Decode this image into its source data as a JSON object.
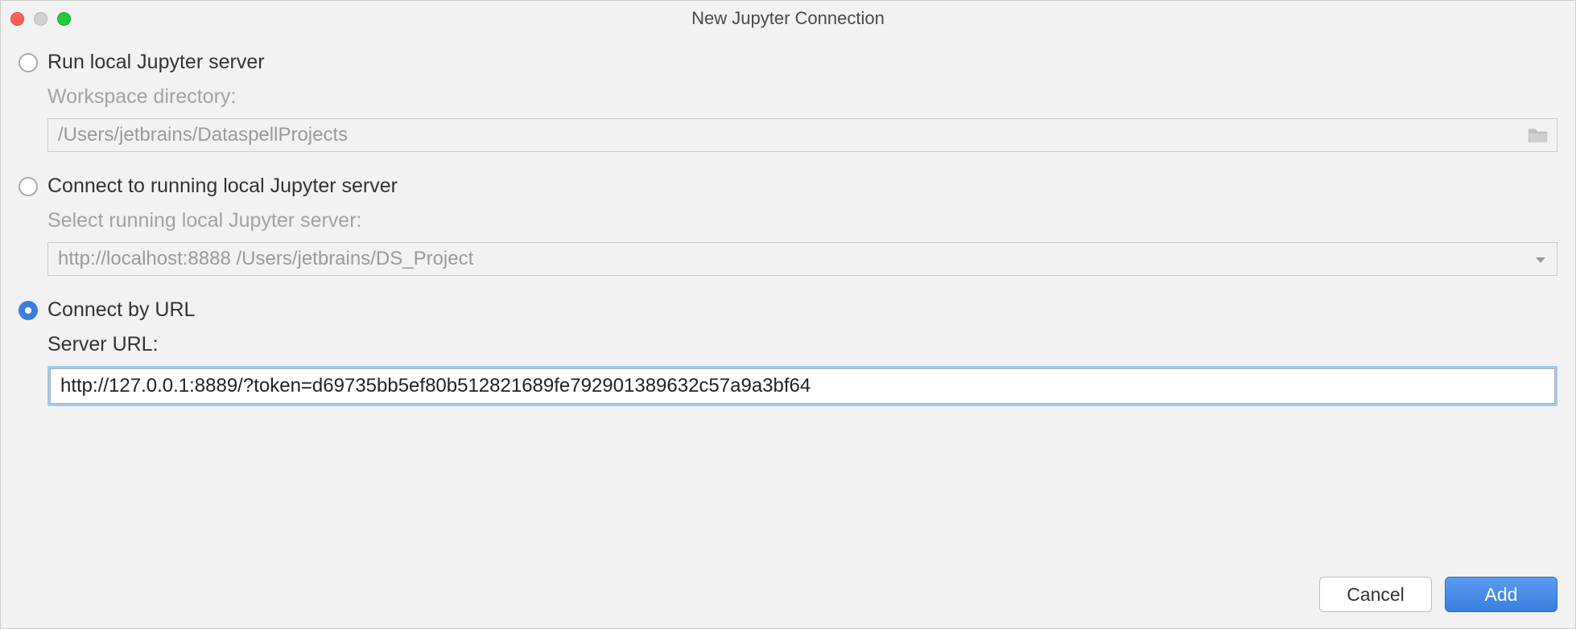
{
  "dialog": {
    "title": "New Jupyter Connection"
  },
  "options": {
    "runLocal": {
      "label": "Run local Jupyter server",
      "workspaceLabel": "Workspace directory:",
      "workspaceValue": "/Users/jetbrains/DataspellProjects"
    },
    "connectLocal": {
      "label": "Connect to running local Jupyter server",
      "selectLabel": "Select running local Jupyter server:",
      "selectValue": "http://localhost:8888 /Users/jetbrains/DS_Project"
    },
    "connectUrl": {
      "label": "Connect by URL",
      "urlLabel": "Server URL:",
      "urlValue": "http://127.0.0.1:8889/?token=d69735bb5ef80b512821689fe792901389632c57a9a3bf64"
    }
  },
  "buttons": {
    "cancel": "Cancel",
    "add": "Add"
  }
}
